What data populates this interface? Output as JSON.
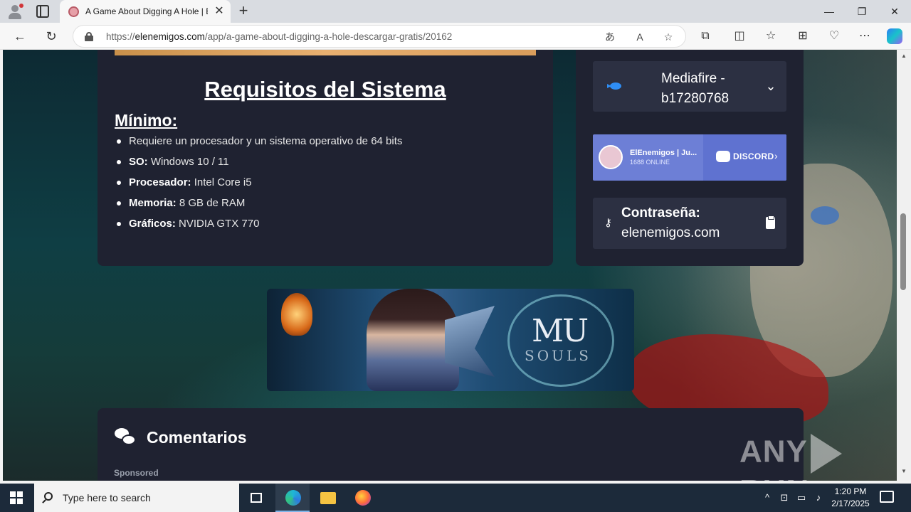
{
  "browser": {
    "tab_title": "A Game About Digging A Hole | E",
    "tab_close": "✕",
    "new_tab": "+",
    "url_prefix": "https://",
    "url_domain": "elenemigos.com",
    "url_path": "/app/a-game-about-digging-a-hole-descargar-gratis/20162",
    "window": {
      "minimize": "—",
      "restore": "❐",
      "close": "✕"
    }
  },
  "page": {
    "requirements": {
      "title": "Requisitos del Sistema",
      "subtitle": "Mínimo:",
      "items": [
        {
          "label": "",
          "value": "Requiere un procesador y un sistema operativo de 64 bits"
        },
        {
          "label": "SO:",
          "value": " Windows 10 / 11"
        },
        {
          "label": "Procesador:",
          "value": " Intel Core i5"
        },
        {
          "label": "Memoria:",
          "value": " 8 GB de RAM"
        },
        {
          "label": "Gráficos:",
          "value": " NVIDIA GTX 770"
        }
      ]
    },
    "download": {
      "mirror_label": "Mediafire - b17280768",
      "discord": {
        "server": "ElEnemigos | Ju...",
        "online": "1688 ONLINE",
        "brand": "DISCORD"
      },
      "password_label": "Contraseña:",
      "password_value": "elenemigos.com"
    },
    "banner": {
      "logo_main": "MU",
      "logo_sub": "SOULS"
    },
    "comments": {
      "title": "Comentarios",
      "sponsored": "Sponsored"
    },
    "watermark": {
      "left": "ANY",
      "right": "RUN"
    }
  },
  "taskbar": {
    "search_placeholder": "Type here to search",
    "time": "1:20 PM",
    "date": "2/17/2025"
  },
  "colors": {
    "card_bg": "#1f2231",
    "button_bg": "#2c3042",
    "discord": "#6d7fd6",
    "taskbar": "#1c2a3a"
  }
}
